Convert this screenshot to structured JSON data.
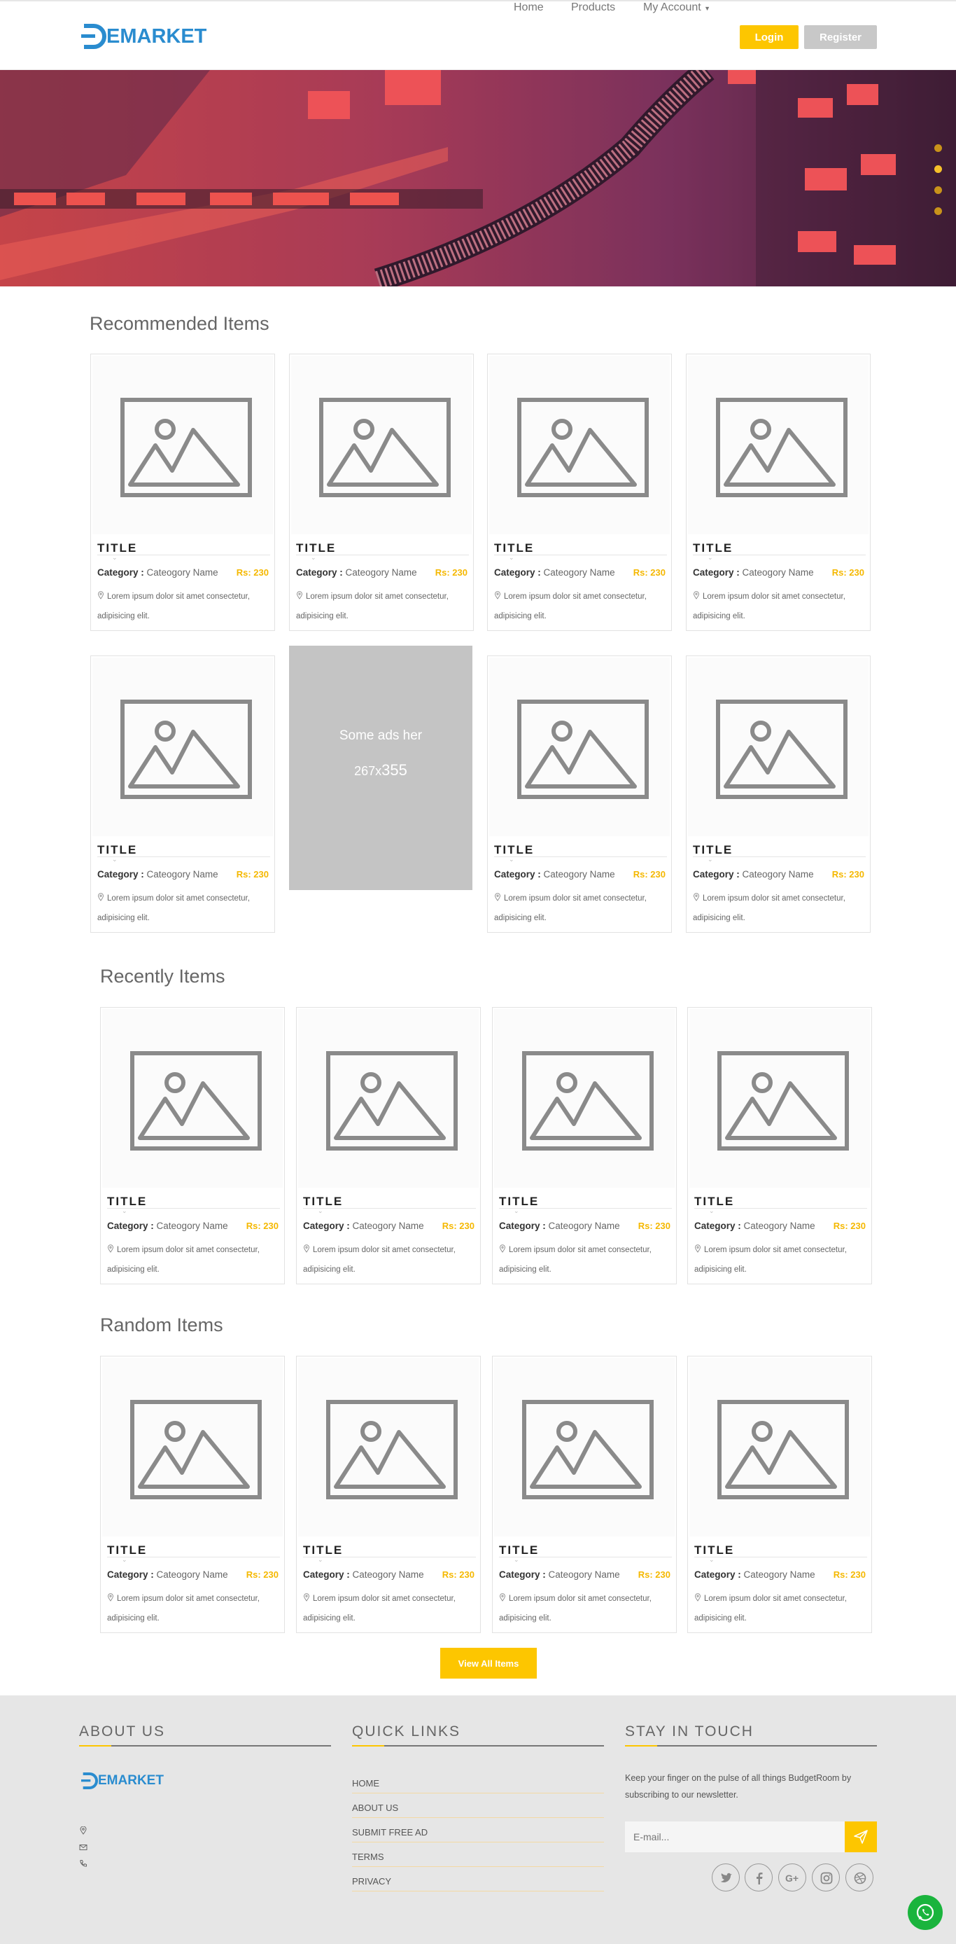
{
  "brand": {
    "logo_text": "EMARKET",
    "primary_color": "#2a8ccf",
    "accent_color": "#fdc600"
  },
  "nav": {
    "links": [
      "Home",
      "Products",
      "My Account"
    ],
    "login_label": "Login",
    "register_label": "Register"
  },
  "hero": {
    "slides": 4,
    "active_slide": 2
  },
  "sections": {
    "recommended": "Recommended Items",
    "recently": "Recently Items",
    "random": "Random Items"
  },
  "card": {
    "title": "TITLE",
    "category_label": "Category :",
    "category_value": "Cateogory Name",
    "price": "Rs: 230",
    "desc": "Lorem ipsum dolor sit amet consectetur, adipisicing elit."
  },
  "ad": {
    "line1": "Some ads her",
    "line2_small": "267x",
    "line2_big": "355"
  },
  "view_all_label": "View All Items",
  "footer": {
    "about_heading": "ABOUT US",
    "links_heading": "QUICK LINKS",
    "touch_heading": "STAY IN TOUCH",
    "logo_text": "EMARKET",
    "links": [
      "HOME",
      "ABOUT US",
      "SUBMIT FREE AD",
      "TERMS",
      "PRIVACY"
    ],
    "newsletter_text": "Keep your finger on the pulse of all things BudgetRoom by subscribing to our newsletter.",
    "email_placeholder": "E-mail...",
    "social_icons": [
      "twitter-icon",
      "facebook-icon",
      "google-plus-icon",
      "instagram-icon",
      "dribbble-icon"
    ]
  }
}
